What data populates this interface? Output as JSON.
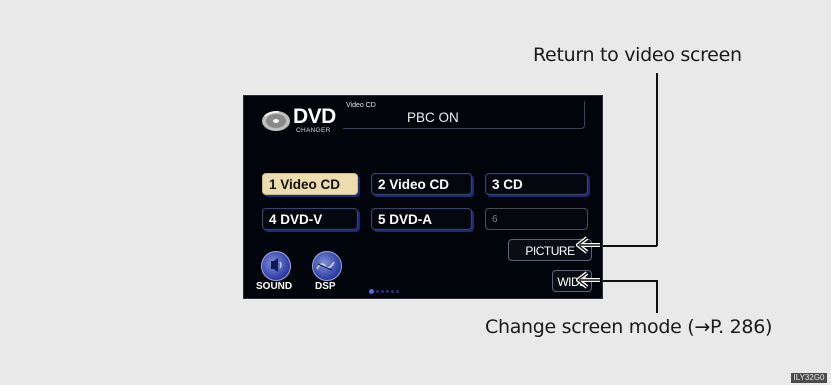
{
  "callouts": {
    "return_label": "Return to video screen",
    "mode_label": "Change screen mode (→P. 286)"
  },
  "screen": {
    "header": {
      "logo_title": "DVD",
      "logo_subtitle": "CHANGER",
      "media_type": "Video CD",
      "pbc_status": "PBC ON"
    },
    "disc_slots": [
      {
        "label": "1 Video CD",
        "active": true
      },
      {
        "label": "2 Video CD",
        "active": false
      },
      {
        "label": "3 CD",
        "active": false
      },
      {
        "label": "4 DVD-V",
        "active": false
      },
      {
        "label": "5 DVD-A",
        "active": false
      },
      {
        "label": "6",
        "active": false,
        "disabled": true
      }
    ],
    "buttons": {
      "picture": "PICTURE",
      "wide": "WIDE",
      "sound": "SOUND",
      "dsp": "DSP"
    }
  },
  "figure_code": "ILY32G0",
  "colors": {
    "background": "#e9e9ea",
    "screen_bg": "#02040b",
    "active_slot": "#ecdcae",
    "accent_blue": "#2c3aa0"
  },
  "icons": [
    "disc-icon",
    "sound-icon",
    "dsp-icon",
    "pointer-arrow-icon"
  ]
}
